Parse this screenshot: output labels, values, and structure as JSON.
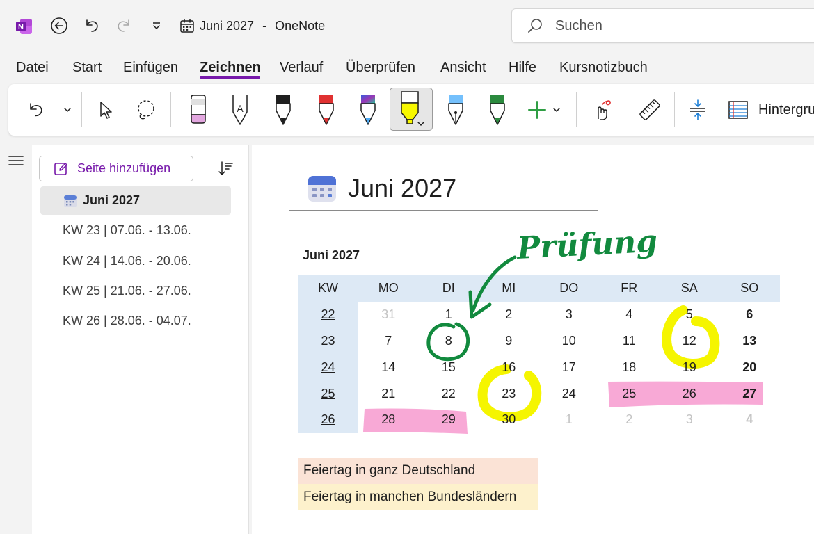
{
  "app": {
    "doc_title": "Juni 2027",
    "separator": "-",
    "app_name": "OneNote",
    "search_placeholder": "Suchen"
  },
  "menu": [
    "Datei",
    "Start",
    "Einfügen",
    "Zeichnen",
    "Verlauf",
    "Überprüfen",
    "Ansicht",
    "Hilfe",
    "Kursnotizbuch"
  ],
  "active_menu": "Zeichnen",
  "ribbon": {
    "background_label": "Hintergru",
    "tools": [
      "undo-icon",
      "lasso-select-icon",
      "eraser-icon",
      "pen-icon",
      "highlighter-icon",
      "ruler-icon",
      "add-space-icon"
    ]
  },
  "sidebar": {
    "add_page_label": "Seite hinzufügen",
    "pages": [
      {
        "label": "Juni 2027",
        "selected": true
      },
      {
        "label": "KW 23 | 07.06. - 13.06.",
        "selected": false
      },
      {
        "label": "KW 24 | 14.06. - 20.06.",
        "selected": false
      },
      {
        "label": "KW 25 | 21.06. - 27.06.",
        "selected": false
      },
      {
        "label": "KW 26 | 28.06. - 04.07.",
        "selected": false
      }
    ]
  },
  "page": {
    "title": "Juni 2027",
    "calendar_heading": "Juni 2027",
    "calendar": {
      "headers": [
        "KW",
        "MO",
        "DI",
        "MI",
        "DO",
        "FR",
        "SA",
        "SO"
      ],
      "rows": [
        {
          "kw": "22",
          "days": [
            "31",
            "1",
            "2",
            "3",
            "4",
            "5",
            "6"
          ]
        },
        {
          "kw": "23",
          "days": [
            "7",
            "8",
            "9",
            "10",
            "11",
            "12",
            "13"
          ]
        },
        {
          "kw": "24",
          "days": [
            "14",
            "15",
            "16",
            "17",
            "18",
            "19",
            "20"
          ]
        },
        {
          "kw": "25",
          "days": [
            "21",
            "22",
            "23",
            "24",
            "25",
            "26",
            "27"
          ]
        },
        {
          "kw": "26",
          "days": [
            "28",
            "29",
            "30",
            "1",
            "2",
            "3",
            "4"
          ]
        }
      ]
    },
    "ink_note": "Prüfung",
    "legend": [
      {
        "label": "Feiertag in ganz Deutschland",
        "color": "#fbe3d6"
      },
      {
        "label": "Feiertag in manchen Bundesländern",
        "color": "#fdf1cc"
      }
    ]
  },
  "colors": {
    "accent": "#7719aa",
    "header_bg": "#dde9f5",
    "highlighter_yellow": "#f5f500",
    "highlighter_pink": "#f7a0d2",
    "ink_green": "#128a3e"
  }
}
